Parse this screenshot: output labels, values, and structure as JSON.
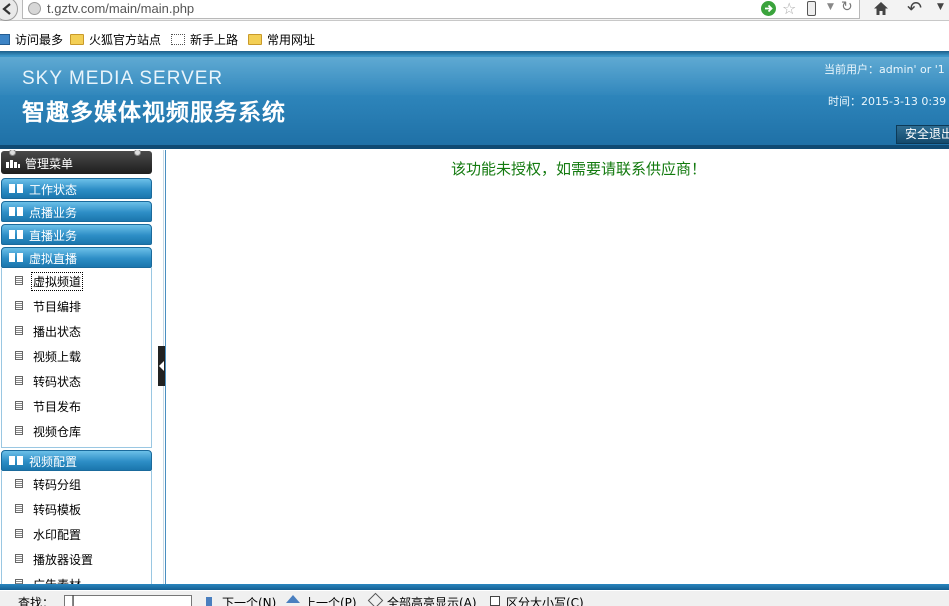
{
  "browser": {
    "url": "t.gztv.com/main/main.php",
    "bookmarks": [
      {
        "label": "访问最多",
        "icon": "bookmark-icon"
      },
      {
        "label": "火狐官方站点",
        "icon": "folder-icon"
      },
      {
        "label": "新手上路",
        "icon": "dotted-page-icon"
      },
      {
        "label": "常用网址",
        "icon": "folder-icon"
      }
    ]
  },
  "header": {
    "brand_en": "SKY MEDIA SERVER",
    "brand_cn": "智趣多媒体视频服务系统",
    "current_user": "当前用户：admin' or '1",
    "time": "时间：2015-3-13 0:39",
    "logout_label": "安全退出"
  },
  "sidebar": {
    "title": "管理菜单",
    "sections": [
      {
        "label": "工作状态"
      },
      {
        "label": "点播业务"
      },
      {
        "label": "直播业务"
      },
      {
        "label": "虚拟直播",
        "items": [
          "虚拟频道",
          "节目编排",
          "播出状态",
          "视频上载",
          "转码状态",
          "节目发布",
          "视频仓库"
        ]
      },
      {
        "label": "视频配置",
        "items": [
          "转码分组",
          "转码模板",
          "水印配置",
          "播放器设置",
          "广告素材"
        ]
      }
    ]
  },
  "main": {
    "notice": "该功能未授权，如需要请联系供应商！"
  },
  "findbar": {
    "label": "查找：",
    "value": "|",
    "next_label": "下一个(N)",
    "prev_label": "上一个(P)",
    "highlight_label": "全部高亮显示(A)",
    "case_label": "区分大小写(C)"
  },
  "colors": {
    "banner_blue": "#2f87bd",
    "section_blue": "#2d8ec6",
    "notice_green": "#137a0f"
  }
}
